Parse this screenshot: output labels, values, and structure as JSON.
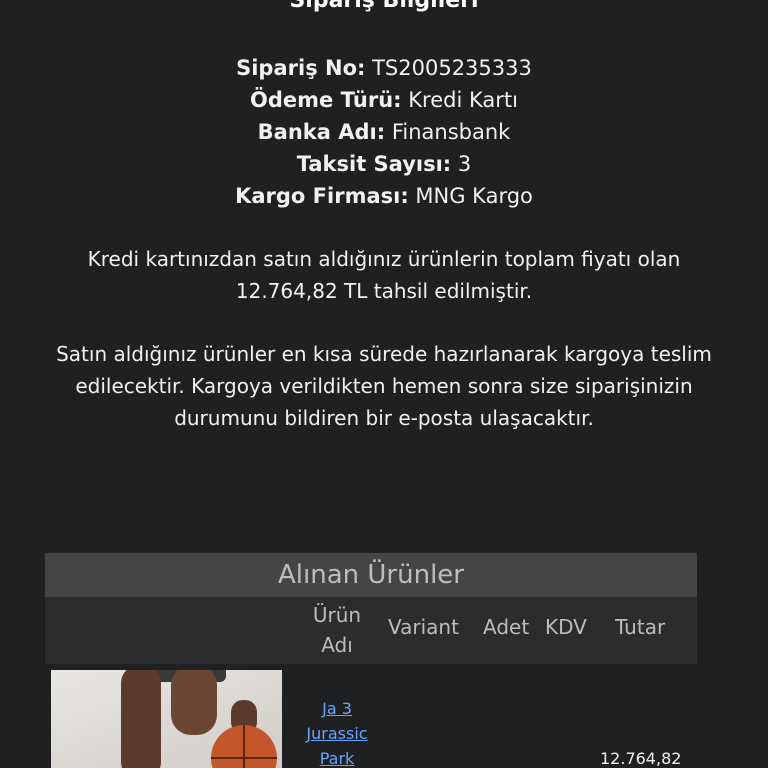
{
  "order_info": {
    "title": "Sipariş Bilgileri",
    "rows": [
      {
        "label": "Sipariş No:",
        "value": "TS2005235333"
      },
      {
        "label": "Ödeme Türü:",
        "value": "Kredi Kartı"
      },
      {
        "label": "Banka Adı:",
        "value": "Finansbank"
      },
      {
        "label": "Taksit Sayısı:",
        "value": "3"
      },
      {
        "label": "Kargo Firması:",
        "value": "MNG Kargo"
      }
    ]
  },
  "messages": {
    "payment": "Kredi kartınızdan satın aldığınız ürünlerin toplam fiyatı olan 12.764,82 TL tahsil edilmiştir.",
    "shipping": "Satın aldığınız ürünler en kısa sürede hazırlanarak kargoya teslim edilecektir. Kargoya verildikten hemen sonra size siparişinizin durumunu bildiren bir e-posta ulaşacaktır."
  },
  "products": {
    "title": "Alınan Ürünler",
    "columns": {
      "name": "Ürün Adı",
      "variant": "Variant",
      "quantity": "Adet",
      "vat": "KDV",
      "total": "Tutar"
    },
    "items": [
      {
        "name": "Ja 3 Jurassic Park",
        "price": "12.764,82"
      }
    ]
  },
  "colors": {
    "background": "#1f2022",
    "table_title_bg": "#434547",
    "table_header_bg": "#2b2c2e",
    "link": "#6aa5ff"
  }
}
